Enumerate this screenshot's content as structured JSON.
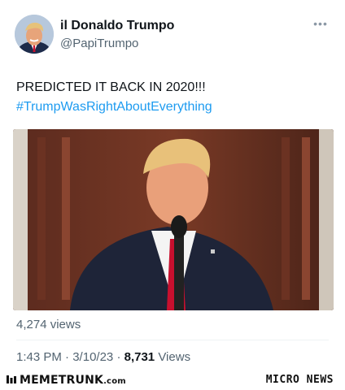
{
  "tweet": {
    "display_name": "il Donaldo Trumpo",
    "handle": "@PapiTrumpo",
    "text": "PREDICTED IT BACK IN 2020!!!",
    "hashtag": "#TrumpWasRightAboutEverything",
    "media_views": "4,274 views",
    "time": "1:43 PM",
    "date": "3/10/23",
    "separator": "·",
    "view_count": "8,731",
    "views_label": "Views",
    "more_icon": "more-dots-icon"
  },
  "footer": {
    "left_brand": "MEMETRUNK",
    "left_brand_suffix": ".com",
    "right_brand": "MICRO NEWS"
  },
  "colors": {
    "hashtag": "#1d9bf0",
    "secondary_text": "#536471",
    "primary_text": "#0f1419"
  }
}
